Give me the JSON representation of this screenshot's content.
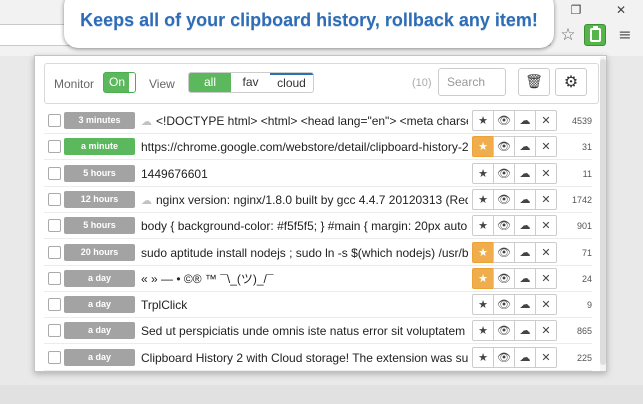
{
  "window": {
    "restore_glyph": "❐",
    "close_glyph": "✕"
  },
  "toolbar_icons": {
    "star_glyph": "☆",
    "menu_glyph": "≡"
  },
  "banner": {
    "text": "Keeps all of your clipboard history, rollback any item!"
  },
  "popup": {
    "monitor_label": "Monitor",
    "monitor_state": "On",
    "view_label": "View",
    "view_options": [
      "all",
      "fav",
      "cloud"
    ],
    "count": "(10)",
    "search_placeholder": "Search",
    "trash_glyph": "🗑",
    "gear_glyph": "⚙"
  },
  "actions": {
    "star": "★",
    "eye": "👁",
    "upload": "☁",
    "delete": "✕",
    "cloud_mark": "☁"
  },
  "colors": {
    "accent_green": "#5cb85c",
    "fav_orange": "#f0ad4e",
    "time_gray": "#a3a3a3",
    "banner_blue": "#2e6db5"
  },
  "rows": [
    {
      "time": "3 minutes",
      "text": "<!DOCTYPE html> <html> <head lang=\"en\"> <meta charset=\"U",
      "size": "4539",
      "fav": false,
      "cloud": true,
      "recent": false
    },
    {
      "time": "a minute",
      "text": "https://chrome.google.com/webstore/detail/clipboard-history-2/ajiej",
      "size": "31",
      "fav": true,
      "cloud": false,
      "recent": true
    },
    {
      "time": "5 hours",
      "text": "1449676601",
      "size": "11",
      "fav": false,
      "cloud": false,
      "recent": false
    },
    {
      "time": "12 hours",
      "text": "nginx version: nginx/1.8.0 built by gcc 4.4.7 20120313 (Red Ha",
      "size": "1742",
      "fav": false,
      "cloud": true,
      "recent": false
    },
    {
      "time": "5 hours",
      "text": "body { background-color: #f5f5f5; } #main { margin: 20px auto 0; wi",
      "size": "901",
      "fav": false,
      "cloud": false,
      "recent": false
    },
    {
      "time": "20 hours",
      "text": "sudo aptitude install nodejs ; sudo ln -s $(which nodejs) /usr/bin/n",
      "size": "71",
      "fav": true,
      "cloud": false,
      "recent": false
    },
    {
      "time": "a day",
      "text": "« » — • ©® ™ ¯\\_(ツ)_/¯",
      "size": "24",
      "fav": true,
      "cloud": false,
      "recent": false
    },
    {
      "time": "a day",
      "text": "TrplClick",
      "size": "9",
      "fav": false,
      "cloud": false,
      "recent": false
    },
    {
      "time": "a day",
      "text": "Sed ut perspiciatis unde omnis iste natus error sit voluptatem accu",
      "size": "865",
      "fav": false,
      "cloud": false,
      "recent": false
    },
    {
      "time": "a day",
      "text": "Clipboard History 2 with Cloud storage! The extension was succes",
      "size": "225",
      "fav": false,
      "cloud": false,
      "recent": false
    }
  ]
}
